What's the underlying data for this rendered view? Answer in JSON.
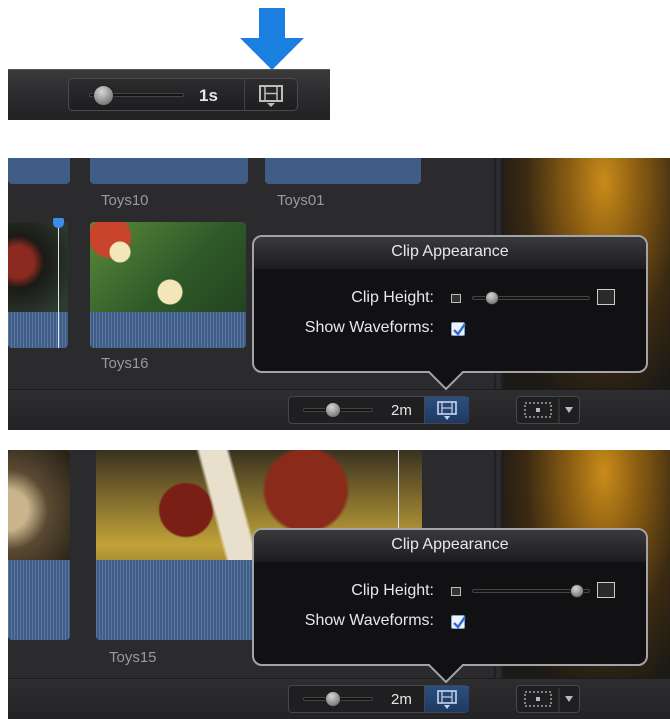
{
  "top_toolbar": {
    "zoom_value": "1s",
    "zoom_level": 0.15,
    "clip_appearance_button": "film-strip-icon",
    "callout_arrow_color": "#1a7fe0"
  },
  "panel1": {
    "clip_labels": {
      "toys10": "Toys10",
      "toys01": "Toys01",
      "toys16": "Toys16"
    },
    "popover": {
      "title": "Clip Appearance",
      "clip_height_label": "Clip Height:",
      "clip_height_value": 0.1,
      "show_waveforms_label": "Show Waveforms:",
      "show_waveforms_checked": true
    },
    "zoom_value": "2m"
  },
  "panel2": {
    "clip_labels": {
      "toys15": "Toys15"
    },
    "popover": {
      "title": "Clip Appearance",
      "clip_height_label": "Clip Height:",
      "clip_height_value": 0.85,
      "show_waveforms_label": "Show Waveforms:",
      "show_waveforms_checked": true
    },
    "zoom_value": "2m"
  },
  "colors": {
    "accent_blue": "#1a7fe0",
    "waveform_blue": "#3f5d86",
    "selected_button": "#2d4f7e"
  }
}
